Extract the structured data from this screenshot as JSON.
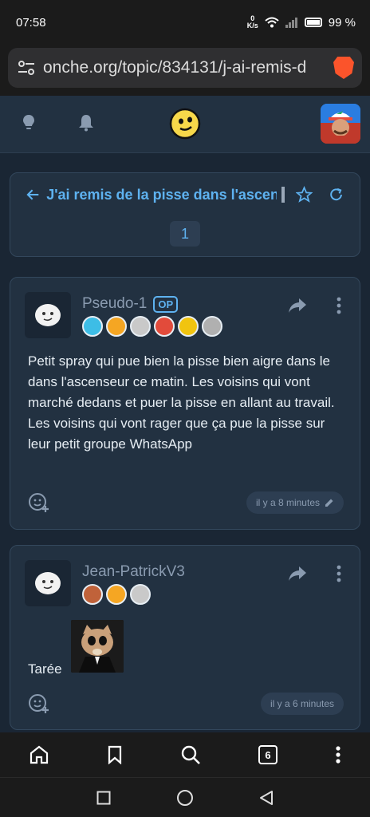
{
  "status": {
    "time": "07:58",
    "speed_value": "0",
    "speed_unit": "K/s",
    "battery": "99 %"
  },
  "browser": {
    "url": "onche.org/topic/834131/j-ai-remis-d"
  },
  "topic": {
    "title": "J'ai remis de la pisse dans l'ascenseur",
    "page": "1"
  },
  "posts": [
    {
      "author": "Pseudo-1",
      "op_badge": "OP",
      "badges": [
        "#3dbde6",
        "#f5a623",
        "#c9c9c9",
        "#e24b3b",
        "#f1c40f",
        "#b0b0b0"
      ],
      "body": "Petit spray qui pue bien la pisse bien aigre dans le dans l'ascenseur ce matin. Les voisins qui vont marché dedans et puer la pisse en allant au travail. Les voisins qui vont rager que ça pue la pisse sur leur petit groupe WhatsApp",
      "time": "il y a 8 minutes"
    },
    {
      "author": "Jean-PatrickV3",
      "badges": [
        "#c0623a",
        "#f5a623",
        "#c9c9c9"
      ],
      "body": "Tarée",
      "time": "il y a 6 minutes"
    }
  ],
  "bottom_nav": {
    "tab_count": "6"
  },
  "colors": {
    "accent": "#5eb2f0",
    "background": "#1a2634",
    "card": "#223141"
  }
}
